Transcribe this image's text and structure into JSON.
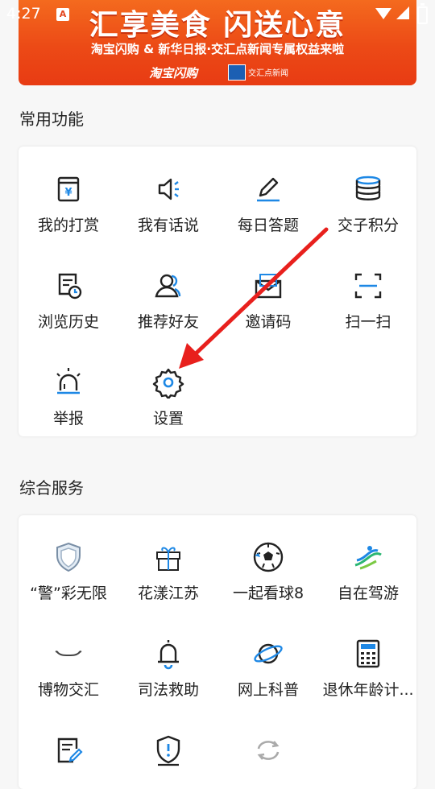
{
  "status": {
    "time": "4:27"
  },
  "banner": {
    "title": "汇享美食 闪送心意",
    "subtitle": "淘宝闪购 & 新华日报·交汇点新闻专属权益来啦",
    "logo_left": "淘宝闪购",
    "logo_right": "交汇点新闻"
  },
  "common_section": {
    "title": "常用功能",
    "items": [
      {
        "label": "我的打赏",
        "icon": "reward-box-icon"
      },
      {
        "label": "我有话说",
        "icon": "speaker-icon"
      },
      {
        "label": "每日答题",
        "icon": "pencil-icon"
      },
      {
        "label": "交子积分",
        "icon": "coin-stack-icon"
      },
      {
        "label": "浏览历史",
        "icon": "history-icon"
      },
      {
        "label": "推荐好友",
        "icon": "recommend-friend-icon"
      },
      {
        "label": "邀请码",
        "icon": "envelope-icon"
      },
      {
        "label": "扫一扫",
        "icon": "scan-icon"
      },
      {
        "label": "举报",
        "icon": "alarm-light-icon"
      },
      {
        "label": "设置",
        "icon": "gear-icon"
      }
    ]
  },
  "service_section": {
    "title": "综合服务",
    "items": [
      {
        "label": "“警”彩无限",
        "icon": "police-shield-icon"
      },
      {
        "label": "花漾江苏",
        "icon": "gift-icon"
      },
      {
        "label": "一起看球8",
        "icon": "soccer-ball-icon"
      },
      {
        "label": "自在驾游",
        "icon": "road-trip-icon"
      },
      {
        "label": "博物交汇",
        "icon": "museum-icon"
      },
      {
        "label": "司法救助",
        "icon": "bell-icon"
      },
      {
        "label": "网上科普",
        "icon": "planet-icon"
      },
      {
        "label": "退休年龄计...",
        "icon": "calculator-icon"
      },
      {
        "label": "",
        "icon": "edit-document-icon"
      },
      {
        "label": "",
        "icon": "shield-alert-icon"
      },
      {
        "label": "",
        "icon": "refresh-icon"
      }
    ]
  },
  "colors": {
    "accent": "#1e88e5",
    "banner": "#ec4a16",
    "arrow": "#e8201d"
  }
}
